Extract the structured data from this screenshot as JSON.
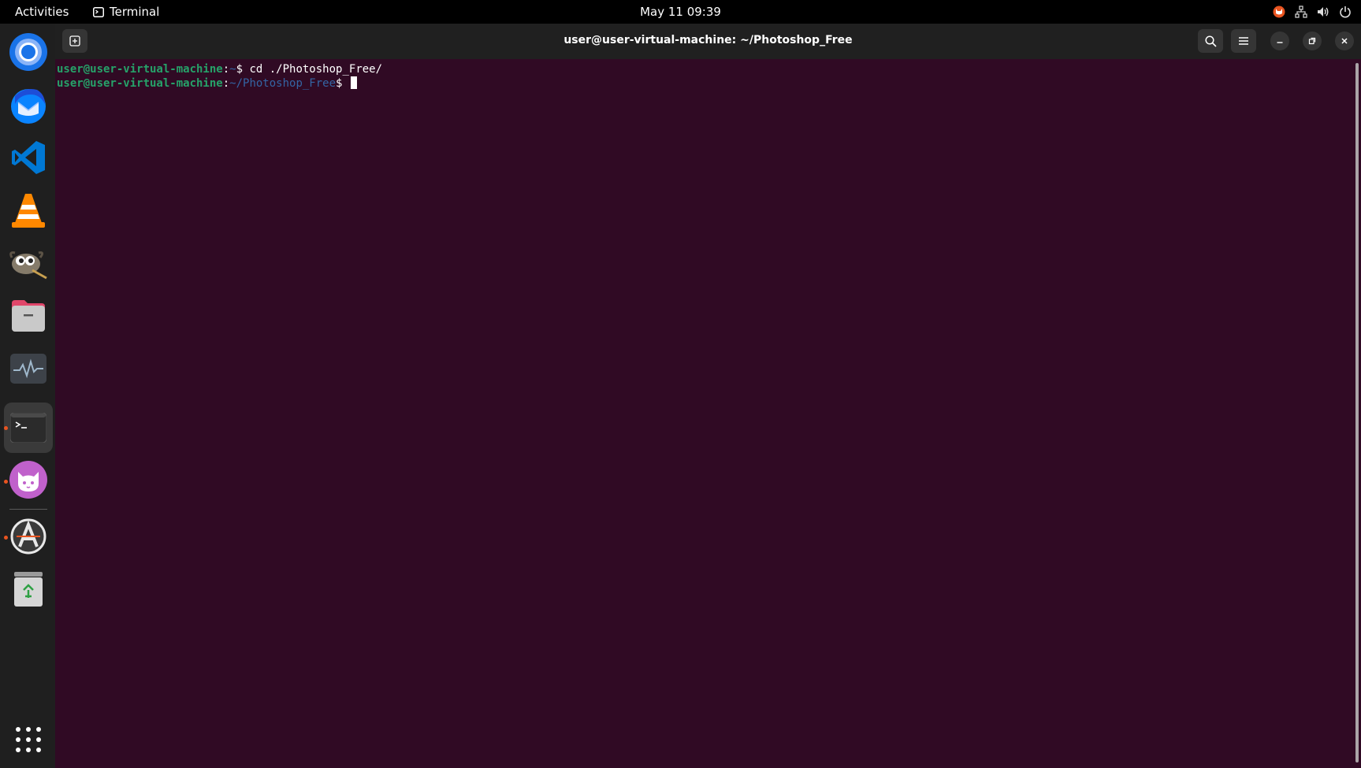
{
  "topbar": {
    "activities": "Activities",
    "app_name": "Terminal",
    "clock": "May 11  09:39",
    "icons": [
      "tray-app-icon",
      "network-icon",
      "volume-icon",
      "power-icon"
    ]
  },
  "dock": {
    "items": [
      {
        "name": "chrome-icon"
      },
      {
        "name": "thunderbird-icon"
      },
      {
        "name": "vscode-icon"
      },
      {
        "name": "vlc-icon"
      },
      {
        "name": "gimp-icon"
      },
      {
        "name": "files-icon"
      },
      {
        "name": "system-monitor-icon"
      },
      {
        "name": "terminal-icon",
        "active": true
      },
      {
        "name": "cat-app-icon"
      },
      {
        "name": "software-updater-icon"
      },
      {
        "name": "trash-icon"
      },
      {
        "name": "show-apps-icon"
      }
    ]
  },
  "window": {
    "title": "user@user-virtual-machine: ~/Photoshop_Free",
    "buttons": [
      "new-tab-icon",
      "search-icon",
      "menu-icon",
      "minimize-icon",
      "maximize-icon",
      "close-icon"
    ]
  },
  "terminal": {
    "lines": [
      {
        "user": "user@user-virtual-machine",
        "sep": ":",
        "path": "~",
        "prompt": "$ ",
        "cmd": "cd ./Photoshop_Free/"
      },
      {
        "user": "user@user-virtual-machine",
        "sep": ":",
        "path": "~/Photoshop_Free",
        "prompt": "$ ",
        "cmd": ""
      }
    ]
  },
  "colors": {
    "terminal_bg": "#300a24",
    "prompt_user": "#26a269",
    "prompt_path": "#3465a4",
    "accent": "#e95420"
  }
}
